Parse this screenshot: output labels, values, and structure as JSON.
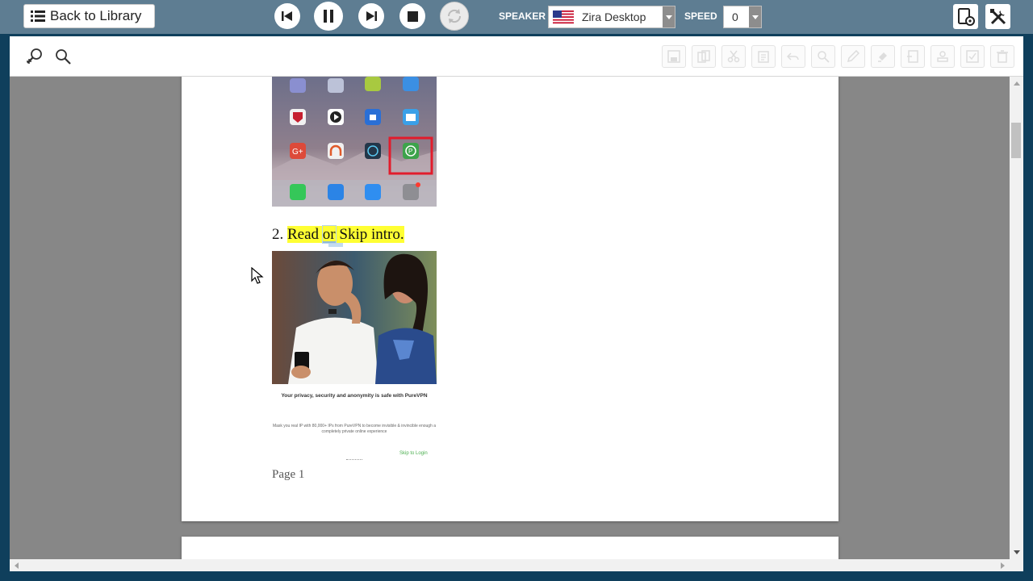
{
  "toolbar": {
    "back_label": "Back to Library",
    "speaker_label": "SPEAKER",
    "speaker_value": "Zira Desktop",
    "speed_label": "SPEED",
    "speed_value": "0",
    "icons": [
      "list-icon",
      "previous-icon",
      "pause-icon",
      "next-icon",
      "stop-icon",
      "repeat-icon",
      "us-flag-icon",
      "device-settings-icon",
      "tools-icon"
    ]
  },
  "editbar": {
    "icons": [
      "zoom-in-icon",
      "zoom-out-icon",
      "save-icon",
      "copy-icon",
      "cut-icon",
      "paste-icon",
      "undo-icon",
      "find-icon",
      "pen-icon",
      "highlight-icon",
      "insert-icon",
      "stamp-icon",
      "check-icon",
      "delete-icon"
    ]
  },
  "document": {
    "step_number": "2.",
    "step_words": [
      "Read",
      "or",
      "Skip intro."
    ],
    "vpn_caption_bold": "Your privacy, security and anonymity is safe with PureVPN",
    "vpn_caption_small": "Mask you real IP with 80,000+ IPs from PureVPN to become invisible & invincible enough a completely private online experience",
    "vpn_link": "Skip to Login",
    "page_label": "Page 1"
  },
  "colors": {
    "toolbar_bg": "#5e7d92",
    "viewport_bg": "#878787",
    "highlight": "#ffff33",
    "selected_word": "#bcd7ef"
  }
}
